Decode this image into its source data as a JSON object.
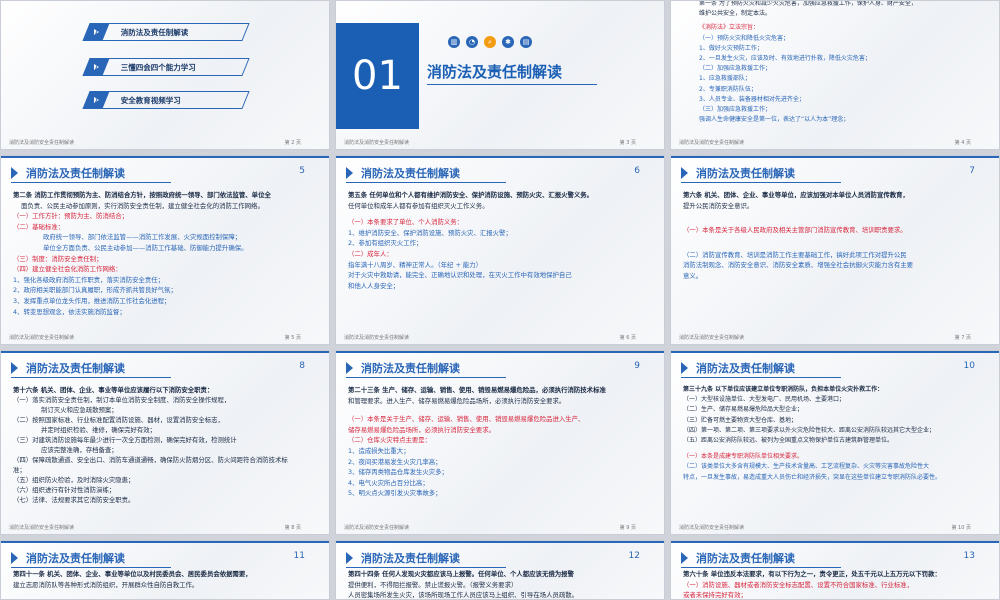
{
  "footer_text": "消防法及消防安全责任制解读",
  "slides": {
    "s1": {
      "menu": [
        "消防法及责任制解读",
        "三懂四会四个能力学习",
        "安全教育视频学习"
      ],
      "page": "第 2 页"
    },
    "s2": {
      "number": "01",
      "title": "消防法及责任制解读",
      "page": "第 3 页"
    },
    "s3": {
      "lines": [
        "第一条 为了预防火灾和减少火灾危害，加强应急救援工作，保护人身、财产安全，",
        "维护公共安全，制定本法。",
        "《消防法》立法宗旨：",
        "（一）预防火灾和降低火灾危害；",
        "1、做好火灾预防工作；",
        "2、一旦发生火灾，应该及时、有效地进行扑救，降低火灾危害；",
        "（二）加强应急救援工作；",
        "1、应急救援部队；",
        "2、专兼职消防队伍；",
        "3、人员专业、装备器材相对先进齐全；",
        "（三）加强应急救援工作；",
        "强调人生命健康安全是第一位，表达了“以人为本”理念；"
      ],
      "page": "第 4 页"
    },
    "s5": {
      "title": "消防法及责任制解读",
      "num": "5",
      "lines": [
        "第二条 消防工作贯彻预防为主、防消结合方针，按照政府统一领导、部门依法监管、单位全",
        "面负责、公民主动参加原则，实行消防安全责任制，建立健全社会化的消防工作网络。",
        "（一）工作方针：预防为主、防消结合；",
        "（二）基础标准：",
        "政府统一领导、部门依法监管——消防工作发展、火灾规面控制保障；",
        "单位全方面负责、公民主动参加——消防工作基础、防御能力提升确保。",
        "（三）制度：消防安全责任制；",
        "（四）建立健全社会化消防工作网络：",
        "1、强化各级政府消防工作职责，落实消防安全责任；",
        "2、政府相关职能部门认真履职，形成齐抓共管良好气氛；",
        "3、发挥重点单位龙头作用，推进消防工作社会化进程；",
        "4、转变思想观念，依法实施消防监督；"
      ],
      "page": "第 5 页"
    },
    "s6": {
      "title": "消防法及责任制解读",
      "num": "6",
      "lines": [
        "第五条 任何单位和个人都有维护消防安全、保护消防设施、预防火灾、汇报火警义务。",
        "任何单位和成年人都有参加有组织灭火工作义务。",
        "（一）本条要求了单位、个人消防义务：",
        "1、维护消防安全、保护消防设施、预防火灾、汇报火警；",
        "2、参加有组织灭火工作；",
        "（二）成年人：",
        "指年满十八周岁、精神正常人。（年纪 + 能力）",
        "对于火灾中救助请，能完全、正确地认识和处理，在灭火工作中有效地保护自己",
        "和他人人身安全；"
      ],
      "page": "第 6 页"
    },
    "s7": {
      "title": "消防法及责任制解读",
      "num": "7",
      "lines": [
        "第六条 机关、团体、企业、事业等单位，应该加强对本单位人员消防宣传教育，",
        "提升公民消防安全意识。",
        "（一）本条是关于各级人民政府及相关主管部门消防宣传教育、培训职责要求。",
        "（二）消防宣传教育、培训是消防工作主要基础工作，搞好此项工作对提升公民",
        "消防法制观念、消防安全意识、消防安全素质、增强全社会抗御火灾能力含有主要",
        "意义。"
      ],
      "page": "第 7 页"
    },
    "s8": {
      "title": "消防法及责任制解读",
      "num": "8",
      "lines": [
        "第十六条 机关、团体、企业、事业等单位应该履行以下消防安全职责：",
        "（一）落实消防安全责任制，制订本单位消防安全制度、消防安全操作规程，",
        "制订灭火和应急疏散预案；",
        "（二）按照国家标准、行业标准配置消防设施、器材，设置消防安全标志，",
        "并定时组织检验、维修，确保完好有效；",
        "（三）对建筑消防设施每年最少进行一次全方面检测，确保完好有效，检测统计",
        "应该完整准确，存档备查；",
        "（四）保障疏散通道、安全出口、消防车通道通畅，确保防火防烟分区、防火间距符合消防技术标",
        "准；",
        "（五）组织防火检验，及时消除火灾隐患；",
        "（六）组织进行有针对性消防演练；",
        "（七）法律、法规要求其它消防安全职责。"
      ],
      "page": "第 8 页"
    },
    "s9": {
      "title": "消防法及责任制解读",
      "num": "9",
      "lines": [
        "第二十三条 生产、储存、运输、销售、使用、销毁易燃易爆危险品，必须执行消防技术标准",
        "和管理要求。进入生产、储存易燃易爆危险品场所，必须执行消防安全要求。",
        "（一）本条是关于生产、储存、运输、销售、使用、销毁易燃易爆危险品进入生产、",
        "储存易燃易爆危险品场所，必须执行消防安全要求。",
        "（二）仓库火灾特点主要是：",
        "1、造成损失比重大；",
        "2、夜间买港易发生火灾几率高；",
        "3、储存丙类物品仓库发生火灾多；",
        "4、电气火灾所占百分比高；",
        "5、明火点火源引发火灾事故多；"
      ],
      "page": "第 9 页"
    },
    "s10": {
      "title": "消防法及责任制解读",
      "num": "10",
      "lines": [
        "第三十九条 以下单位应该建立单位专职消防队，负担本单位火灾扑救工作：",
        "（一）大型核设施单位、大型发电厂、民用机场、主要港口；",
        "（二）生产、储存易燃易爆危险品大型企业；",
        "（三）贮备可燃主要物资大型仓库、基地；",
        "（四）第一项、第二项、第三项要求以外火灾危险性较大、距离公安消防队较远其它大型企业；",
        "（五）距离公安消防队较远、被列为全国重点文物保护单位古建筑群管理单位。",
        "（一）本条是成建专职消防队单位相关要求。",
        "（二）该类单位大多含有规模大、生产技术含量高、工艺流程复杂、火灾等灾害事故危险性大",
        "特点，一旦发生事故，易造成重大人员伤亡和经济损失，突显在这些单位建立专职消防队必要性。"
      ],
      "page": "第 10 页"
    },
    "s11": {
      "title": "消防法及责任制解读",
      "num": "11",
      "lines": [
        "第四十一条 机关、团体、企业、事业等单位以及村民委员会、居民委员会依据需要，",
        "建立志愿消防队等各种形式消防组织，开展群众性自防自救工作。"
      ]
    },
    "s12": {
      "title": "消防法及责任制解读",
      "num": "12",
      "lines": [
        "第四十四条 任何人发现火灾都应该马上报警。任何单位、个人都应该无偿为报警",
        "提供便利，不得阻拦报警。禁止谎报火警。（报警义务要求）",
        "人员密集场所发生火灾，该场所现场工作人员应该马上组织、引导在场人员疏散。"
      ]
    },
    "s13": {
      "title": "消防法及责任制解读",
      "num": "13",
      "lines": [
        "第六十条 单位违反本法要求，有以下行为之一，责令更正，处五千元以上五万元以下罚款：",
        "（一）消防设施、器材或者消防安全标志配置、设置不符合国家标准、行业标准，",
        "或者未保持完好有效；"
      ]
    }
  }
}
